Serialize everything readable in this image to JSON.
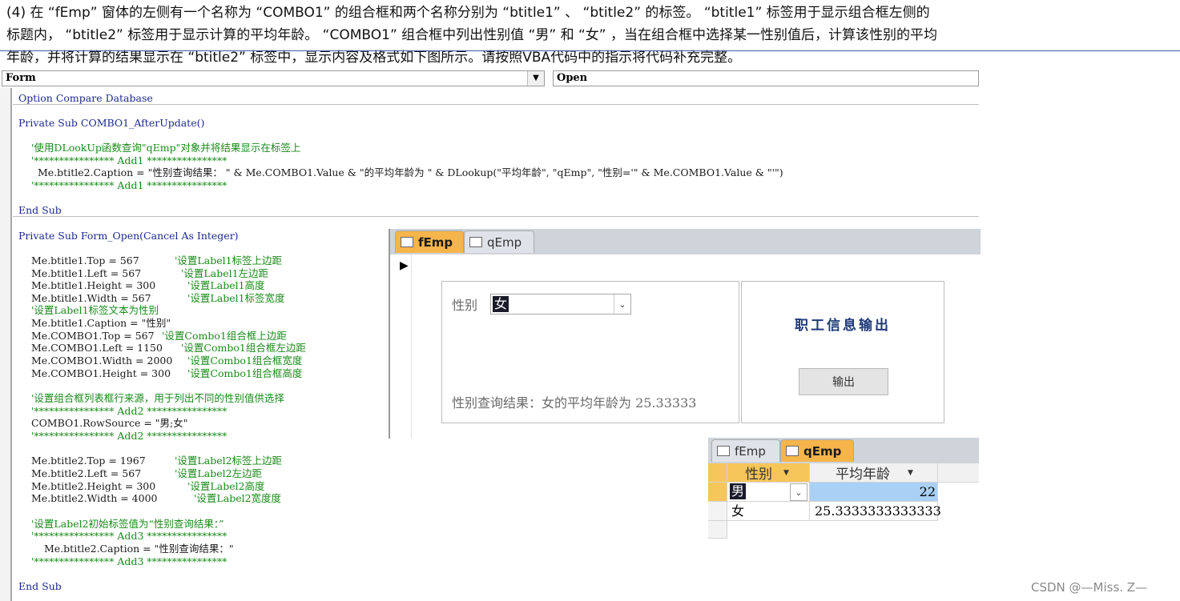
{
  "question": {
    "line1": "(4) 在 “fEmp” 窗体的左侧有一个名称为 “COMBO1” 的组合框和两个名称分别为 “btitle1” 、 “btitle2” 的标签。 “btitle1” 标签用于显示组合框左侧的",
    "line2": "标题内， “btitle2” 标签用于显示计算的平均年龄。 “COMBO1” 组合框中列出性别值 “男” 和 “女” ，当在组合框中选择某一性别值后，计算该性别的平均",
    "line3": "年龄，并将计算的结果显示在 “btitle2” 标签中，显示内容及格式如下图所示。请按照VBA代码中的指示将代码补充完整。"
  },
  "vba": {
    "object_combo": "Form",
    "proc_combo": "Open",
    "lines": {
      "l1": "Option Compare Database",
      "l2": "Private Sub COMBO1_AfterUpdate()",
      "l3": "'使用DLookUp函数查询\"qEmp\"对象并将结果显示在标签上",
      "l4": "'**************** Add1 ****************",
      "l5": "Me.btitle2.Caption = \"性别查询结果： \" & Me.COMBO1.Value & \"的平均年龄为 \" & DLookup(\"平均年龄\", \"qEmp\", \"性别='\" & Me.COMBO1.Value & \"'\")",
      "l6": "'**************** Add1 ****************",
      "l7": "End Sub",
      "l8": "Private Sub Form_Open(Cancel As Integer)",
      "l9": "Me.btitle1.Top = 567",
      "l9c": "'设置Label1标签上边距",
      "l10": "Me.btitle1.Left = 567",
      "l10c": "'设置Label1左边距",
      "l11": "Me.btitle1.Height = 300",
      "l11c": "'设置Label1高度",
      "l12": "Me.btitle1.Width = 567",
      "l12c": "'设置Label1标签宽度",
      "l13": "'设置Label1标签文本为性别",
      "l14": "Me.btitle1.Caption = \"性别\"",
      "l15": "Me.COMBO1.Top = 567",
      "l15c": "'设置Combo1组合框上边距",
      "l16": "Me.COMBO1.Left = 1150",
      "l16c": "'设置Combo1组合框左边距",
      "l17": "Me.COMBO1.Width = 2000",
      "l17c": "'设置Combo1组合框宽度",
      "l18": "Me.COMBO1.Height = 300",
      "l18c": "'设置Combo1组合框高度",
      "l19": "'设置组合框列表框行来源，用于列出不同的性别值供选择",
      "l20": "'**************** Add2 ****************",
      "l21": "COMBO1.RowSource = \"男;女\"",
      "l22": "'**************** Add2 ****************",
      "l23": "Me.btitle2.Top = 1967",
      "l23c": "'设置Label2标签上边距",
      "l24": "Me.btitle2.Left = 567",
      "l24c": "'设置Label2左边距",
      "l25": "Me.btitle2.Height = 300",
      "l25c": "'设置Label2高度",
      "l26": "Me.btitle2.Width = 4000",
      "l26c": "'设置Label2宽度度",
      "l27": "'设置Label2初始标签值为“性别查询结果：”",
      "l28": "'**************** Add3 ****************",
      "l29": "Me.btitle2.Caption = \"性别查询结果：\"",
      "l30": "'**************** Add3 ****************",
      "l31": "End Sub"
    }
  },
  "form": {
    "tab_active": "fEmp",
    "tab_other": "qEmp",
    "label_gender": "性别",
    "combo_value": "女",
    "result_text": "性别查询结果：女的平均年龄为 25.33333",
    "title": "职工信息输出",
    "button": "输出"
  },
  "query": {
    "tab_other": "fEmp",
    "tab_active": "qEmp",
    "col1": "性别",
    "col2": "平均年龄",
    "rows": [
      {
        "gender": "男",
        "age": "22"
      },
      {
        "gender": "女",
        "age": "25.3333333333333"
      }
    ]
  },
  "watermark": "CSDN @—Miss. Z—",
  "colors": {
    "tab_active": "#f6b54a",
    "keyword": "#1c2a8c",
    "comment": "#1a8a1a"
  }
}
